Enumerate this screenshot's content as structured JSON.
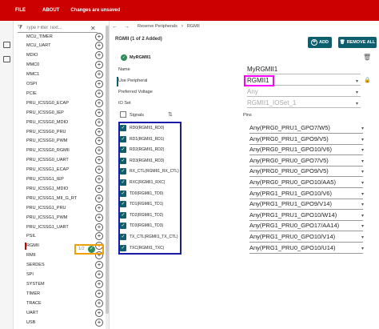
{
  "topbar": {
    "file": "FILE",
    "about": "ABOUT",
    "status": "Changes are unsaved"
  },
  "filter": {
    "placeholder": "Type Filter Text..."
  },
  "peripherals": [
    "MCU_TIMER",
    "MCU_UART",
    "MDIO",
    "MMC0",
    "MMC1",
    "OSPI",
    "PCIE",
    "PRU_ICSSG0_ECAP",
    "PRU_ICSSG0_IEP",
    "PRU_ICSSG0_MDIO",
    "PRU_ICSSG0_PRU",
    "PRU_ICSSG0_PWM",
    "PRU_ICSSG0_RGMII",
    "PRU_ICSSG0_UART",
    "PRU_ICSSG1_ECAP",
    "PRU_ICSSG1_IEP",
    "PRU_ICSSG1_MDIO",
    "PRU_ICSSG1_MII_G_RT",
    "PRU_ICSSG1_PRU",
    "PRU_ICSSG1_PWM",
    "PRU_ICSSG1_UART",
    "PSIL",
    "RGMII",
    "RMII",
    "SERDES",
    "SPI",
    "SYSTEM",
    "TIMER",
    "TRACE",
    "UART",
    "USB"
  ],
  "selected_count": "1/2",
  "breadcrumb": {
    "parent": "Reserve Peripherals",
    "current": "RGMII"
  },
  "panel": {
    "title": "RGMII (1 of 2 Added)",
    "add": "ADD",
    "remove_all": "REMOVE ALL"
  },
  "instance": {
    "name": "MyRGMII1"
  },
  "fields": {
    "name_label": "Name",
    "name_value": "MyRGMII1",
    "use_label": "Use Peripheral",
    "use_value": "RGMII1",
    "voltage_label": "Preferred Voltage",
    "voltage_value": "Any",
    "ioset_label": "IO Set",
    "ioset_value": "RGMII1_IOSet_1"
  },
  "signals_header": {
    "signals": "Signals",
    "pins": "Pins"
  },
  "signals": [
    {
      "name": "RD0(RGMII1_RD0)",
      "pin": "Any(PRG0_PRU1_GPO7/W5)"
    },
    {
      "name": "RD1(RGMII1_RD1)",
      "pin": "Any(PRG0_PRU1_GPO9/V5)"
    },
    {
      "name": "RD2(RGMII1_RD2)",
      "pin": "Any(PRG0_PRU1_GPO10/V6)"
    },
    {
      "name": "RD3(RGMII1_RD3)",
      "pin": "Any(PRG0_PRU0_GPO7/V5)"
    },
    {
      "name": "RX_CTL(RGMII1_RX_CTL)",
      "pin": "Any(PRG0_PRU0_GPO9/V5)"
    },
    {
      "name": "RXC(RGMII1_RXC)",
      "pin": "Any(PRG0_PRU0_GPO10/AA5)"
    },
    {
      "name": "TD0(RGMII1_TD0)",
      "pin": "Any(PRG1_PRU1_GPO10/V6)"
    },
    {
      "name": "TD1(RGMII1_TD1)",
      "pin": "Any(PRG1_PRU1_GPO9/V14)"
    },
    {
      "name": "TD2(RGMII1_TD2)",
      "pin": "Any(PRG1_PRU1_GPO10/W14)"
    },
    {
      "name": "TD3(RGMII1_TD3)",
      "pin": "Any(PRG1_PRU0_GPO17/AA14)"
    },
    {
      "name": "TX_CTL(RGMII1_TX_CTL)",
      "pin": "Any(PRG1_PRU0_GPO10/V14)"
    },
    {
      "name": "TXC(RGMII1_TXC)",
      "pin": "Any(PRG1_PRU0_GPO10/U14)"
    }
  ],
  "icons": {
    "back": "chevron-left-icon",
    "forward": "chevron-right-icon",
    "filter": "filter-icon",
    "clear": "close-icon",
    "add": "add-circle-icon",
    "trash": "trash-icon",
    "lock": "lock-icon",
    "sort": "sort-icon",
    "check": "check-icon"
  },
  "colors": {
    "brand": "#cc0000",
    "accent": "#0e5f6e",
    "success": "#2e8b57"
  }
}
